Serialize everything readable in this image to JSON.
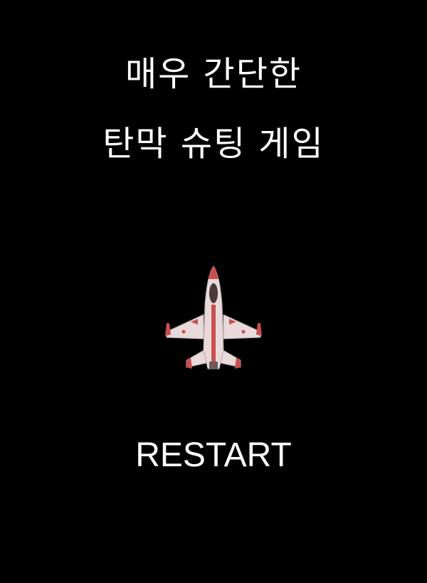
{
  "game": {
    "title_line_1": "매우 간단한",
    "title_line_2": "탄막 슈팅 게임",
    "restart_label": "RESTART",
    "player_sprite": "fighter-jet-icon"
  },
  "colors": {
    "background": "#000000",
    "text": "#ffffff",
    "jet_body": "#e8dada",
    "jet_accent": "#c94f4f",
    "jet_canopy": "#4a3a3a"
  }
}
